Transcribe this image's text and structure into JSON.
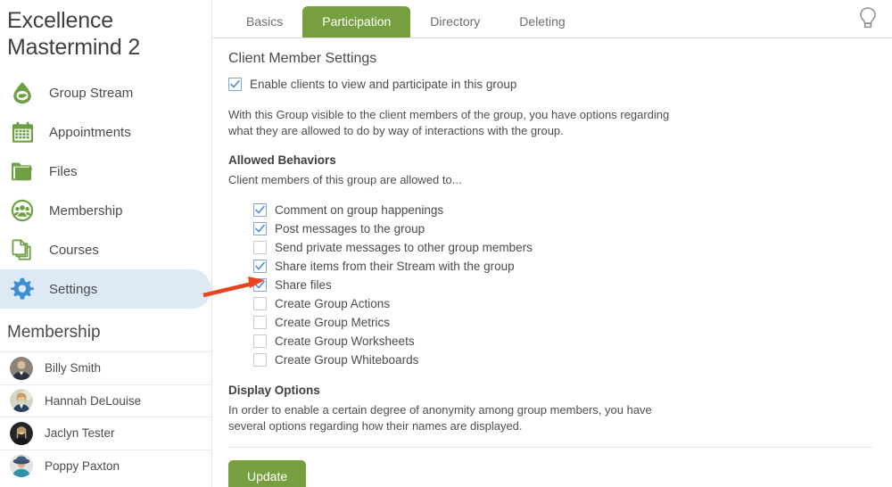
{
  "sidebar": {
    "group_title": "Excellence Mastermind 2",
    "nav_items": [
      {
        "label": "Group Stream",
        "icon": "stream-drop-icon",
        "active": false,
        "color": "#6f9f43"
      },
      {
        "label": "Appointments",
        "icon": "calendar-icon",
        "active": false,
        "color": "#6f9f43"
      },
      {
        "label": "Files",
        "icon": "folder-icon",
        "active": false,
        "color": "#6f9f43"
      },
      {
        "label": "Membership",
        "icon": "people-group-icon",
        "active": false,
        "color": "#6f9f43"
      },
      {
        "label": "Courses",
        "icon": "pages-stack-icon",
        "active": false,
        "color": "#6f9f43"
      },
      {
        "label": "Settings",
        "icon": "gear-icon",
        "active": true,
        "color": "#3d8fd1"
      }
    ],
    "membership_heading": "Membership",
    "members": [
      {
        "name": "Billy Smith",
        "avatar": "avatar-billy"
      },
      {
        "name": "Hannah DeLouise",
        "avatar": "avatar-hannah"
      },
      {
        "name": "Jaclyn Tester",
        "avatar": "avatar-jaclyn"
      },
      {
        "name": "Poppy Paxton",
        "avatar": "avatar-poppy"
      }
    ]
  },
  "tabs": [
    {
      "label": "Basics",
      "active": false
    },
    {
      "label": "Participation",
      "active": true
    },
    {
      "label": "Directory",
      "active": false
    },
    {
      "label": "Deleting",
      "active": false
    }
  ],
  "help_icon": "lightbulb-icon",
  "main": {
    "client_member_settings_heading": "Client Member Settings",
    "enable_clients": {
      "label": "Enable clients to view and participate in this group",
      "checked": true
    },
    "intro_paragraph": "With this Group visible to the client members of the group, you have options regarding what they are allowed to do by way of interactions with the group.",
    "allowed_behaviors_heading": "Allowed Behaviors",
    "allowed_behaviors_subtitle": "Client members of this group are allowed to...",
    "behaviors": [
      {
        "label": "Comment on group happenings",
        "checked": true,
        "check_color": "#5b8fd0"
      },
      {
        "label": "Post messages to the group",
        "checked": true,
        "check_color": "#5b8fd0"
      },
      {
        "label": "Send private messages to other group members",
        "checked": false,
        "check_color": ""
      },
      {
        "label": "Share items from their Stream with the group",
        "checked": true,
        "check_color": "#5b8fd0"
      },
      {
        "label": "Share files",
        "checked": true,
        "check_color": "#5b8fd0"
      },
      {
        "label": "Create Group Actions",
        "checked": false,
        "check_color": ""
      },
      {
        "label": "Create Group Metrics",
        "checked": false,
        "check_color": ""
      },
      {
        "label": "Create Group Worksheets",
        "checked": false,
        "check_color": ""
      },
      {
        "label": "Create Group Whiteboards",
        "checked": false,
        "check_color": ""
      }
    ],
    "display_options_heading": "Display Options",
    "display_options_paragraph": "In order to enable a certain degree of anonymity among group members, you have several options regarding how their names are displayed.",
    "update_button": "Update"
  },
  "annotation": {
    "type": "red-arrow",
    "color": "#e8441f",
    "points_at": "Share files"
  },
  "colors": {
    "brand_green": "#76a040",
    "accent_blue": "#3d8fd1",
    "highlight_blue": "#ddeaf6",
    "checkbox_blue": "#5b8fd0",
    "annotation_red": "#e8441f"
  }
}
